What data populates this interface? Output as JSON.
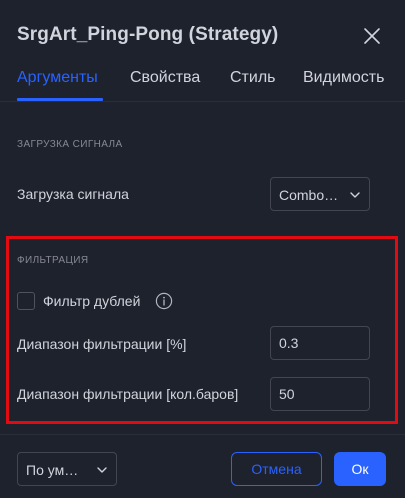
{
  "dialog": {
    "title": "SrgArt_Ping-Pong (Strategy)",
    "close_icon": "close-icon"
  },
  "tabs": [
    {
      "label": "Аргументы",
      "active": true
    },
    {
      "label": "Свойства",
      "active": false
    },
    {
      "label": "Стиль",
      "active": false
    },
    {
      "label": "Видимость",
      "active": false
    }
  ],
  "signal_section": {
    "heading": "ЗАГРУЗКА СИГНАЛА",
    "signal_load_label": "Загрузка сигнала",
    "signal_load_value": "Combo…"
  },
  "filter_section": {
    "heading": "ФИЛЬТРАЦИЯ",
    "duplicate_filter_label": "Фильтр дублей",
    "duplicate_filter_checked": false,
    "range_percent_label": "Диапазон фильтрации [%]",
    "range_percent_value": "0.3",
    "range_bars_label": "Диапазон фильтрации [кол.баров]",
    "range_bars_value": "50"
  },
  "footer": {
    "defaults_value": "По ум…",
    "cancel_label": "Отмена",
    "ok_label": "Ок"
  },
  "colors": {
    "background": "#1e222d",
    "accent": "#2962ff",
    "highlight": "#e20b12",
    "text": "#d1d4dc",
    "muted": "#868993"
  }
}
